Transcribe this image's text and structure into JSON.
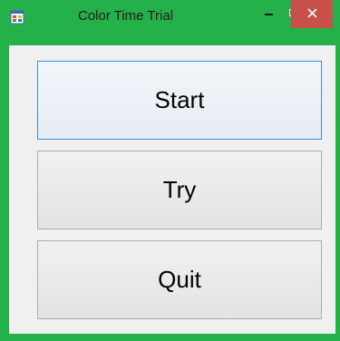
{
  "window": {
    "title": "Color Time Trial",
    "title_bar_color": "#24b14a",
    "close_button_color": "#c7504b",
    "app_icon": "winforms-app-icon",
    "controls": {
      "minimize_icon": "minimize-icon",
      "maximize_icon": "maximize-icon",
      "close_label": "×"
    }
  },
  "buttons": {
    "start_label": "Start",
    "try_label": "Try",
    "quit_label": "Quit"
  }
}
